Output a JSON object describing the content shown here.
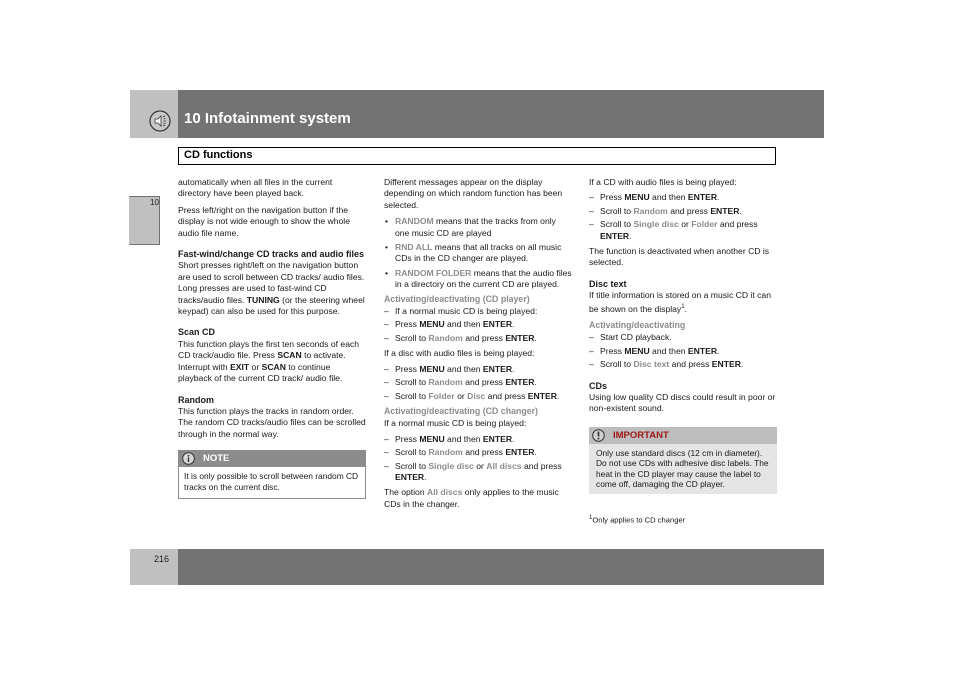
{
  "header": {
    "chapter_title": "10 Infotainment system",
    "icon": "speaker-icon",
    "section": "CD functions"
  },
  "margin_tab": {
    "number": "10"
  },
  "footer": {
    "page_number": "216"
  },
  "col1": {
    "p1": "automatically when all files in the current directory have been played back.",
    "p2": "Press left/right on the navigation button if the display is not wide enough to show the whole audio file name.",
    "h_fastwind": "Fast-wind/change CD tracks and audio files",
    "fastwind_a": "Short presses right/left on the navigation button are used to scroll between CD tracks/ audio files. Long presses are used to fast-wind CD tracks/audio files. ",
    "fastwind_bold": "TUNING",
    "fastwind_b": " (or the steering wheel keypad) can also be used for this purpose.",
    "h_scan": "Scan CD",
    "scan_a": "This function plays the first ten seconds of each CD track/audio file. Press ",
    "scan_b1": "SCAN",
    "scan_b": " to activate. Interrupt with ",
    "scan_b2": "EXIT",
    "scan_c": " or ",
    "scan_b3": "SCAN",
    "scan_d": " to continue playback of the current CD track/ audio file.",
    "h_random": "Random",
    "random_text": "This function plays the tracks in random order. The random CD tracks/audio files can be scrolled through in the normal way.",
    "note": {
      "icon": "info-icon",
      "label": "NOTE",
      "text": "It is only possible to scroll between random CD tracks on the current disc."
    }
  },
  "col2": {
    "intro": "Different messages appear on the display depending on which random function has been selected.",
    "bullets": [
      {
        "term": "RANDOM",
        "text": " means that the tracks from only one music CD are played"
      },
      {
        "term": "RND ALL",
        "text": " means that all tracks on all music CDs in the CD changer are played."
      },
      {
        "term": "RANDOM FOLDER",
        "text": " means that the audio files in a directory on the current CD are played."
      }
    ],
    "sub_player": "Activating/deactivating (CD player)",
    "player_steps_a": "If a normal music CD is being played:",
    "press": "Press ",
    "menu": "MENU",
    "and_then": " and then ",
    "enter": "ENTER",
    "dot": ".",
    "scroll_to": "Scroll to ",
    "random": "Random",
    "and_press": " and press ",
    "audio_intro": "If a disc with audio files is being played:",
    "folder": "Folder",
    "or": " or ",
    "disc": "Disc",
    "sub_changer": "Activating/deactivating (CD changer)",
    "changer_intro": "If a normal music CD is being played:",
    "single_disc": "Single disc",
    "all_discs": "All discs",
    "option_a": "The option ",
    "option_b": " only applies to the music CDs in the changer."
  },
  "col3": {
    "intro": "If a CD with audio files is being played:",
    "deact": "The function is deactivated when another CD is selected.",
    "h_disctext": "Disc text",
    "disctext_p": "If title information is stored on a music CD it can be shown on the display",
    "footnote_ref": "1",
    "sub_act": "Activating/deactivating",
    "start": "Start CD playback.",
    "disc_text": "Disc text",
    "h_cds": "CDs",
    "cds_p": "Using low quality CD discs could result in poor or non-existent sound.",
    "important": {
      "icon": "warning-icon",
      "label": "IMPORTANT",
      "text": "Only use standard discs (12 cm in diameter). Do not use CDs with adhesive disc labels. The heat in the CD player may cause the label to come off, damaging the CD player."
    },
    "footnote_num": "1",
    "footnote_text": "Only applies to CD changer"
  },
  "colors": {
    "header_bar": "#737373",
    "header_side": "#c0c0c0",
    "highlight_text": "#8c8c8c",
    "important_label": "#a01818",
    "important_bg": "#e5e5e5"
  }
}
